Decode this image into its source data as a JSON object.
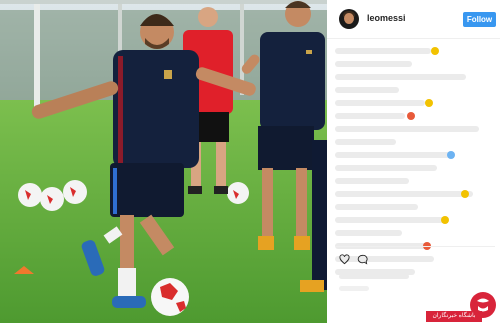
{
  "post": {
    "username": "leomessi",
    "follow_label": "Follow"
  },
  "watermark": {
    "text": "باشگاه خبرنگاران"
  },
  "icons": {
    "avatar": "profile-avatar",
    "like": "heart-icon",
    "comment": "speech-bubble-icon"
  },
  "colors": {
    "follow_button": "#3897f0",
    "watermark": "#d8243a",
    "pitch": "#5aa83a",
    "kit_navy": "#14213d",
    "coach_red": "#e0202a"
  }
}
